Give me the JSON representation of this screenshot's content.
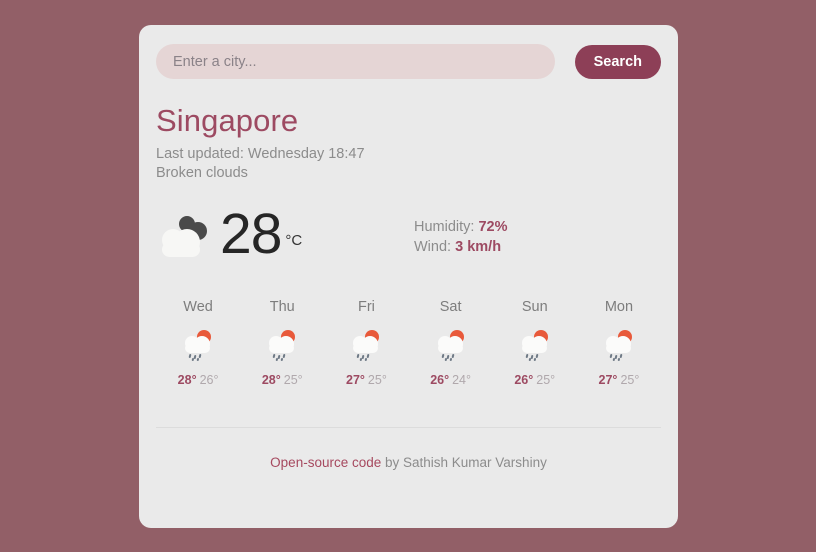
{
  "theme": {
    "page_background": "#925f67",
    "card_background": "#eaeaea",
    "accent": "#8d3f57",
    "accent_text": "#9d4a62",
    "input_background": "#e5d5d5"
  },
  "search": {
    "placeholder": "Enter a city...",
    "value": "",
    "button_label": "Search"
  },
  "current": {
    "city": "Singapore",
    "last_updated": "Last updated: Wednesday 18:47",
    "description": "Broken clouds",
    "icon": "broken-clouds-icon",
    "temperature": "28",
    "unit": "°C",
    "humidity_label": "Humidity:",
    "humidity_value": "72%",
    "wind_label": "Wind:",
    "wind_value": "3 km/h"
  },
  "forecast": [
    {
      "day": "Wed",
      "icon": "sun-behind-rain-cloud-icon",
      "max": "28°",
      "min": "26°"
    },
    {
      "day": "Thu",
      "icon": "sun-behind-rain-cloud-icon",
      "max": "28°",
      "min": "25°"
    },
    {
      "day": "Fri",
      "icon": "sun-behind-rain-cloud-icon",
      "max": "27°",
      "min": "25°"
    },
    {
      "day": "Sat",
      "icon": "sun-behind-rain-cloud-icon",
      "max": "26°",
      "min": "24°"
    },
    {
      "day": "Sun",
      "icon": "sun-behind-rain-cloud-icon",
      "max": "26°",
      "min": "25°"
    },
    {
      "day": "Mon",
      "icon": "sun-behind-rain-cloud-icon",
      "max": "27°",
      "min": "25°"
    }
  ],
  "footer": {
    "link_text": "Open-source code",
    "credit_text": " by Sathish Kumar Varshiny"
  }
}
